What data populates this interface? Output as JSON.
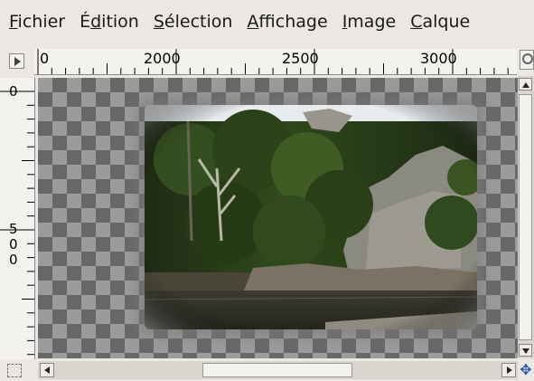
{
  "menubar": {
    "items": [
      {
        "pre": "",
        "mn": "F",
        "post": "ichier"
      },
      {
        "pre": "É",
        "mn": "d",
        "post": "ition"
      },
      {
        "pre": "",
        "mn": "S",
        "post": "élection"
      },
      {
        "pre": "",
        "mn": "A",
        "post": "ffichage"
      },
      {
        "pre": "",
        "mn": "I",
        "post": "mage"
      },
      {
        "pre": "",
        "mn": "C",
        "post": "alque"
      }
    ]
  },
  "hruler": {
    "labels": [
      "0",
      "2000",
      "2500",
      "3000"
    ]
  },
  "vruler": {
    "labels": [
      "0",
      "5",
      "0",
      "0"
    ]
  },
  "icons": {
    "menu_toggle": "triangle-right-icon",
    "zoom": "magnifier-icon",
    "quickmask": "quick-mask-icon",
    "navigate": "navigate-icon"
  },
  "colors": {
    "checker_dark": "#686868",
    "checker_light": "#9b9b9b",
    "ui_bg": "#ebe8e3"
  }
}
